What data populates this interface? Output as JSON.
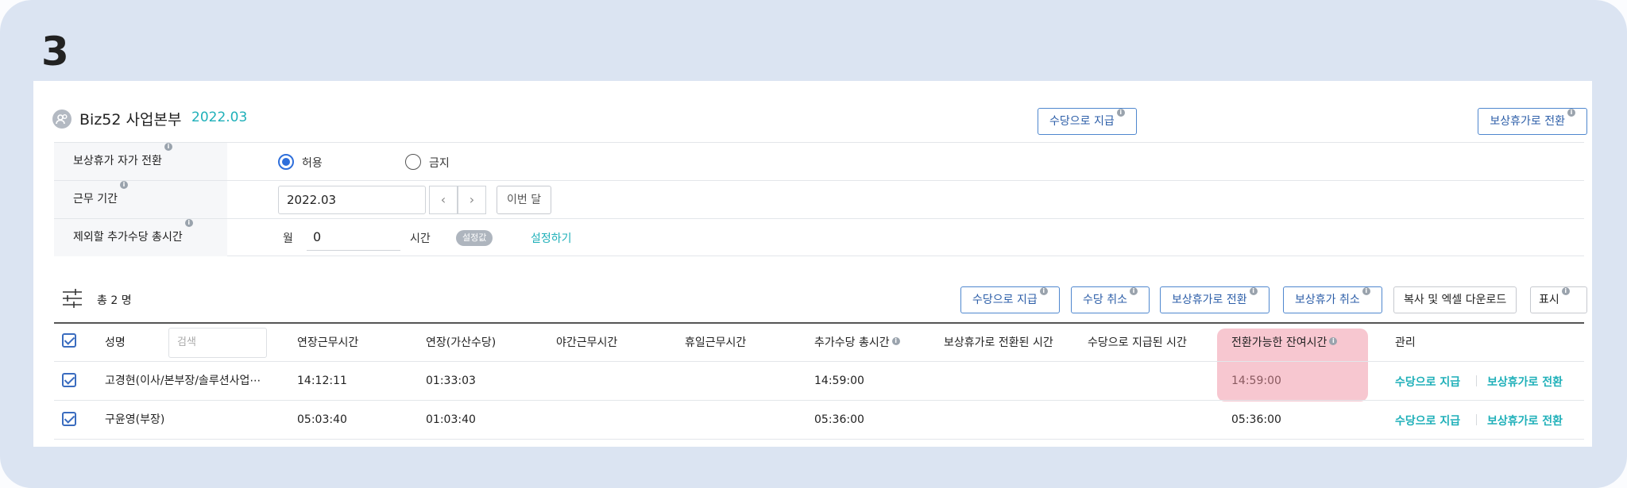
{
  "step_number": "3",
  "header": {
    "department": "Biz52 사업본부",
    "period": "2022.03",
    "buttons": {
      "pay_allowance": "수당으로 지급",
      "convert_leave": "보상휴가로 전환"
    }
  },
  "settings": {
    "auto_convert": {
      "label": "보상휴가 자가 전환",
      "options": [
        "허용",
        "금지"
      ],
      "selected": "허용"
    },
    "work_period": {
      "label": "근무 기간",
      "value": "2022.03",
      "prev": "‹",
      "next": "›",
      "this_month": "이번 달"
    },
    "exclude_hours": {
      "label": "제외할 추가수당 총시간",
      "prefix": "월",
      "value": "0",
      "unit": "시간",
      "badge": "설정값",
      "link": "설정하기"
    }
  },
  "list": {
    "total": "총 2 명",
    "buttons": {
      "pay": "수당으로 지급",
      "cancel_pay": "수당 취소",
      "convert": "보상휴가로 전환",
      "cancel_leave": "보상휴가 취소",
      "copy_excel": "복사 및 엑셀 다운로드",
      "display": "표시"
    }
  },
  "table": {
    "columns": {
      "name": "성명",
      "search_placeholder": "검색",
      "overtime": "연장근무시간",
      "overtime_premium": "연장(가산수당)",
      "night": "야간근무시간",
      "holiday": "휴일근무시간",
      "total_allowance": "추가수당 총시간",
      "converted_leave": "보상휴가로 전환된 시간",
      "paid_allowance": "수당으로 지급된 시간",
      "remaining": "전환가능한 잔여시간",
      "manage": "관리"
    },
    "rows": [
      {
        "name": "고경현(이사/본부장/솔루션사업⋯",
        "overtime": "14:12:11",
        "overtime_premium": "01:33:03",
        "night": "",
        "holiday": "",
        "total_allowance": "14:59:00",
        "converted_leave": "",
        "paid_allowance": "",
        "remaining": "14:59:00"
      },
      {
        "name": "구윤영(부장)",
        "overtime": "05:03:40",
        "overtime_premium": "01:03:40",
        "night": "",
        "holiday": "",
        "total_allowance": "05:36:00",
        "converted_leave": "",
        "paid_allowance": "",
        "remaining": "05:36:00"
      }
    ],
    "row_actions": {
      "pay": "수당으로 지급",
      "convert": "보상휴가로 전환"
    }
  },
  "colors": {
    "accent": "#1fb0b9",
    "button_border": "#4f87ce",
    "highlight": "#f7c7d0",
    "background": "#dbe4f2"
  }
}
